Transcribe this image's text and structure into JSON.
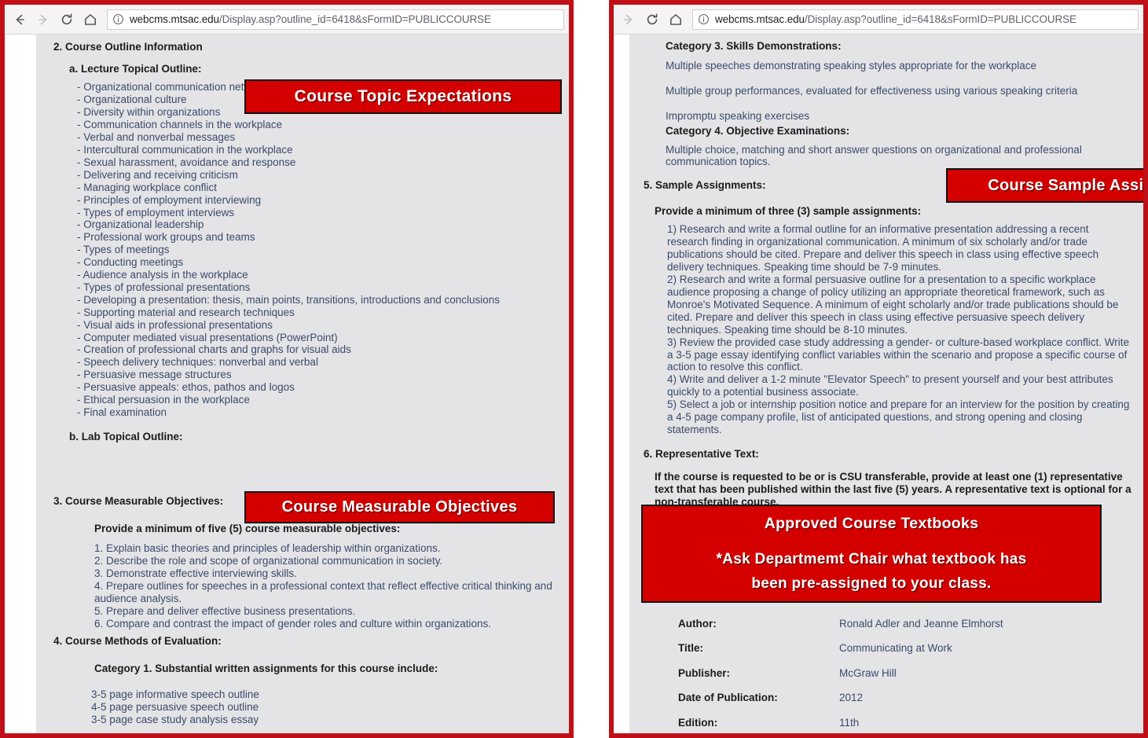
{
  "browser": {
    "url_host": "webcms.mtsac.edu",
    "url_path": "/Display.asp?outline_id=6418&sFormID=PUBLICCOURSE",
    "back_label": "Back",
    "forward_label": "Forward",
    "reload_label": "Reload",
    "home_label": "Home",
    "info_label": "Site information"
  },
  "banners": {
    "topics": "Course Topic Expectations",
    "objectives": "Course Measurable Objectives",
    "samples": "Course Sample Assignments",
    "textbooks_title": "Approved Course Textbooks",
    "textbooks_line1": "*Ask Departmemt Chair what textbook has",
    "textbooks_line2": "been pre-assigned to your class.",
    "color": "#d40000"
  },
  "left_panel": {
    "section2_heading": "2. Course Outline Information",
    "lecture_heading": "a. Lecture Topical Outline:",
    "lecture_topics": [
      "- Organizational communication networks",
      "- Organizational culture",
      "- Diversity within organizations",
      "- Communication channels in the workplace",
      "- Verbal and nonverbal messages",
      "- Intercultural communication in the workplace",
      "- Sexual harassment, avoidance and response",
      "- Delivering and receiving criticism",
      "- Managing workplace conflict",
      "- Principles of employment interviewing",
      "- Types of employment interviews",
      "- Organizational leadership",
      "- Professional work groups and teams",
      "- Types of meetings",
      "- Conducting meetings",
      "- Audience analysis in the workplace",
      "- Types of professional presentations",
      "- Developing a presentation: thesis, main points, transitions, introductions and conclusions",
      "- Supporting material and research techniques",
      "- Visual aids in professional presentations",
      "- Computer mediated visual presentations (PowerPoint)",
      "- Creation of professional charts and graphs for visual aids",
      "- Speech delivery techniques: nonverbal and verbal",
      "- Persuasive message structures",
      "- Persuasive appeals: ethos, pathos and logos",
      "- Ethical persuasion in the workplace",
      "- Final examination"
    ],
    "lab_heading": "b. Lab Topical Outline:",
    "section3_heading": "3. Course Measurable Objectives:",
    "objectives_intro": "Provide a minimum of five (5) course measurable objectives:",
    "objectives": [
      "1. Explain basic theories and principles of leadership within organizations.",
      "2. Describe the role and scope of organizational communication in society.",
      "3. Demonstrate effective interviewing skills.",
      "4. Prepare outlines for speeches in a professional context that reflect effective critical thinking and audience analysis.",
      "5. Prepare and deliver effective business presentations.",
      "6. Compare and contrast the impact of gender roles and culture within organizations."
    ],
    "section4_heading": "4. Course Methods of Evaluation:",
    "category1_heading": "Category 1. Substantial written assignments for this course include:",
    "category1_items": [
      "3-5 page informative speech outline",
      "4-5 page persuasive speech outline",
      "3-5 page case study analysis essay"
    ]
  },
  "right_panel": {
    "category3_heading": "Category 3. Skills Demonstrations:",
    "category3_items": [
      "Multiple speeches demonstrating speaking styles appropriate for the workplace",
      "Multiple group performances, evaluated for effectiveness using various speaking criteria",
      "Impromptu speaking exercises"
    ],
    "category4_heading": "Category 4. Objective Examinations:",
    "category4_text": "Multiple choice, matching and short answer questions on organizational and professional communication topics.",
    "section5_heading": "5. Sample Assignments:",
    "samples_intro": "Provide a minimum of three (3) sample assignments:",
    "samples": [
      "1) Research and write a formal outline for an informative presentation addressing a recent research finding in organizational communication. A minimum of six scholarly and/or trade publications should be cited. Prepare and deliver this speech in class using effective speech delivery techniques. Speaking time should be 7-9 minutes.",
      "2) Research and write a formal persuasive outline for a presentation to a specific workplace audience proposing a change of policy utilizing an appropriate theoretical framework, such as Monroe's Motivated Sequence. A minimum of eight scholarly and/or trade publications should be cited. Prepare and deliver this speech in class using effective persuasive speech delivery techniques. Speaking time should be 8-10 minutes.",
      "3) Review the provided case study addressing a gender- or culture-based workplace conflict. Write a 3-5 page essay identifying conflict variables within the scenario and propose a specific course of action to resolve this conflict.",
      "4) Write and deliver a 1-2 minute \"Elevator Speech\" to present yourself and your best attributes quickly to a potential business associate.",
      "5) Select a job or internship position notice and prepare for an interview for the position by creating a 4-5 page company profile, list of anticipated questions, and strong opening and closing statements."
    ],
    "section6_heading": "6. Representative Text:",
    "section6_note": "If the course is requested to be or is CSU transferable, provide at least one (1) representative text that has been published within the last five (5) years.  A representative text is optional for a non-transferable course.",
    "textbook": [
      {
        "label": "Author:",
        "value": "Ronald Adler and Jeanne Elmhorst"
      },
      {
        "label": "Title:",
        "value": "Communicating at Work"
      },
      {
        "label": "Publisher:",
        "value": "McGraw Hill"
      },
      {
        "label": "Date of Publication:",
        "value": "2012"
      },
      {
        "label": "Edition:",
        "value": "11th"
      }
    ]
  }
}
